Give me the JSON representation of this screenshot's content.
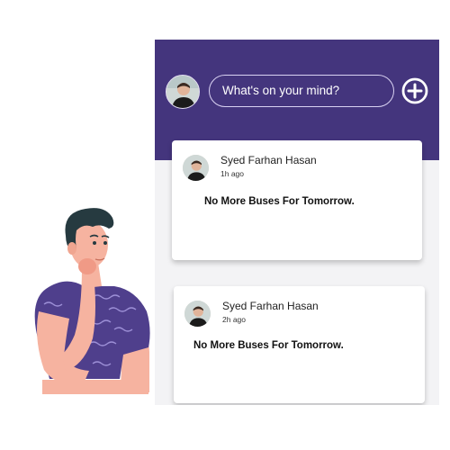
{
  "composer": {
    "placeholder": "What's on your mind?",
    "add_icon": "plus-circle-icon"
  },
  "posts": [
    {
      "author": "Syed Farhan Hasan",
      "time": "1h ago",
      "text": "No More Buses For Tomorrow."
    },
    {
      "author": "Syed Farhan Hasan",
      "time": "2h ago",
      "text": "No More Buses For Tomorrow."
    }
  ],
  "colors": {
    "header": "#44357d",
    "background": "#f3f3f5",
    "card": "#ffffff",
    "shirt": "#4f3f8c",
    "skin": "#f6b3a0",
    "hair": "#263a40"
  },
  "illustration": "thinking-man-illustration"
}
